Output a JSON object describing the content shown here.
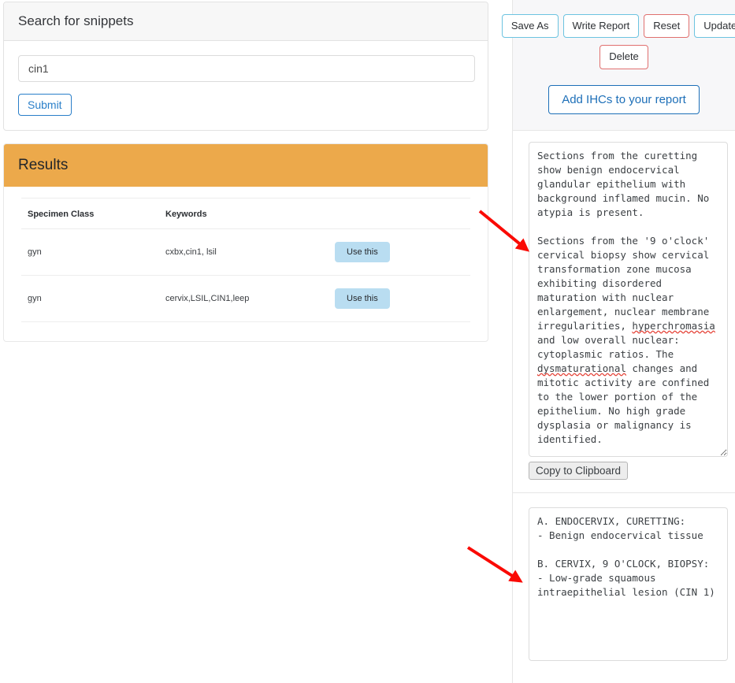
{
  "search_card": {
    "title": "Search for snippets",
    "input_value": "cin1",
    "input_placeholder": "",
    "submit_label": "Submit"
  },
  "results_card": {
    "title": "Results",
    "columns": [
      "Specimen Class",
      "Keywords",
      ""
    ],
    "rows": [
      {
        "specimen_class": "gyn",
        "keywords": "cxbx,cin1, lsil",
        "action_label": "Use this"
      },
      {
        "specimen_class": "gyn",
        "keywords": "cervix,LSIL,CIN1,leep",
        "action_label": "Use this"
      }
    ]
  },
  "toolbar": {
    "save_as_label": "Save As",
    "write_report_label": "Write Report",
    "reset_label": "Reset",
    "update_label": "Update",
    "delete_label": "Delete",
    "add_ihcs_label": "Add IHCs to your report"
  },
  "editor": {
    "report_text_p1": "Sections from the curetting show benign endocervical glandular epithelium with background inflamed mucin. No atypia is present.",
    "report_text_p2_a": "Sections from the '9 o'clock' cervical biopsy show cervical transformation zone mucosa exhibiting disordered maturation with nuclear enlargement, nuclear membrane irregularities, ",
    "report_text_misspelled_1": "hyperchromasia",
    "report_text_p2_b": " and low overall nuclear: cytoplasmic ratios. The ",
    "report_text_misspelled_2": "dysmaturational",
    "report_text_p2_c": " changes and mitotic activity are confined to the lower portion of the epithelium. No high grade dysplasia or malignancy is identified.",
    "copy_label": "Copy to Clipboard"
  },
  "diagnosis": {
    "text": "A. ENDOCERVIX, CURETTING:\n- Benign endocervical tissue\n\nB. CERVIX, 9 O'CLOCK, BIOPSY:\n- Low-grade squamous intraepithelial lesion (CIN 1)"
  },
  "annotations": {
    "arrow_color": "#fa0a04",
    "arrows": [
      {
        "name": "arrow-to-report-textarea"
      },
      {
        "name": "arrow-to-diagnosis-textarea"
      }
    ]
  },
  "colors": {
    "results_header": "#eca94b",
    "use_this_button": "#b9ddf1",
    "primary_blue": "#1d6fb8",
    "info_outline": "#6cc3e0",
    "danger_outline": "#e0706f",
    "panel_gray": "#f7f7f9"
  }
}
